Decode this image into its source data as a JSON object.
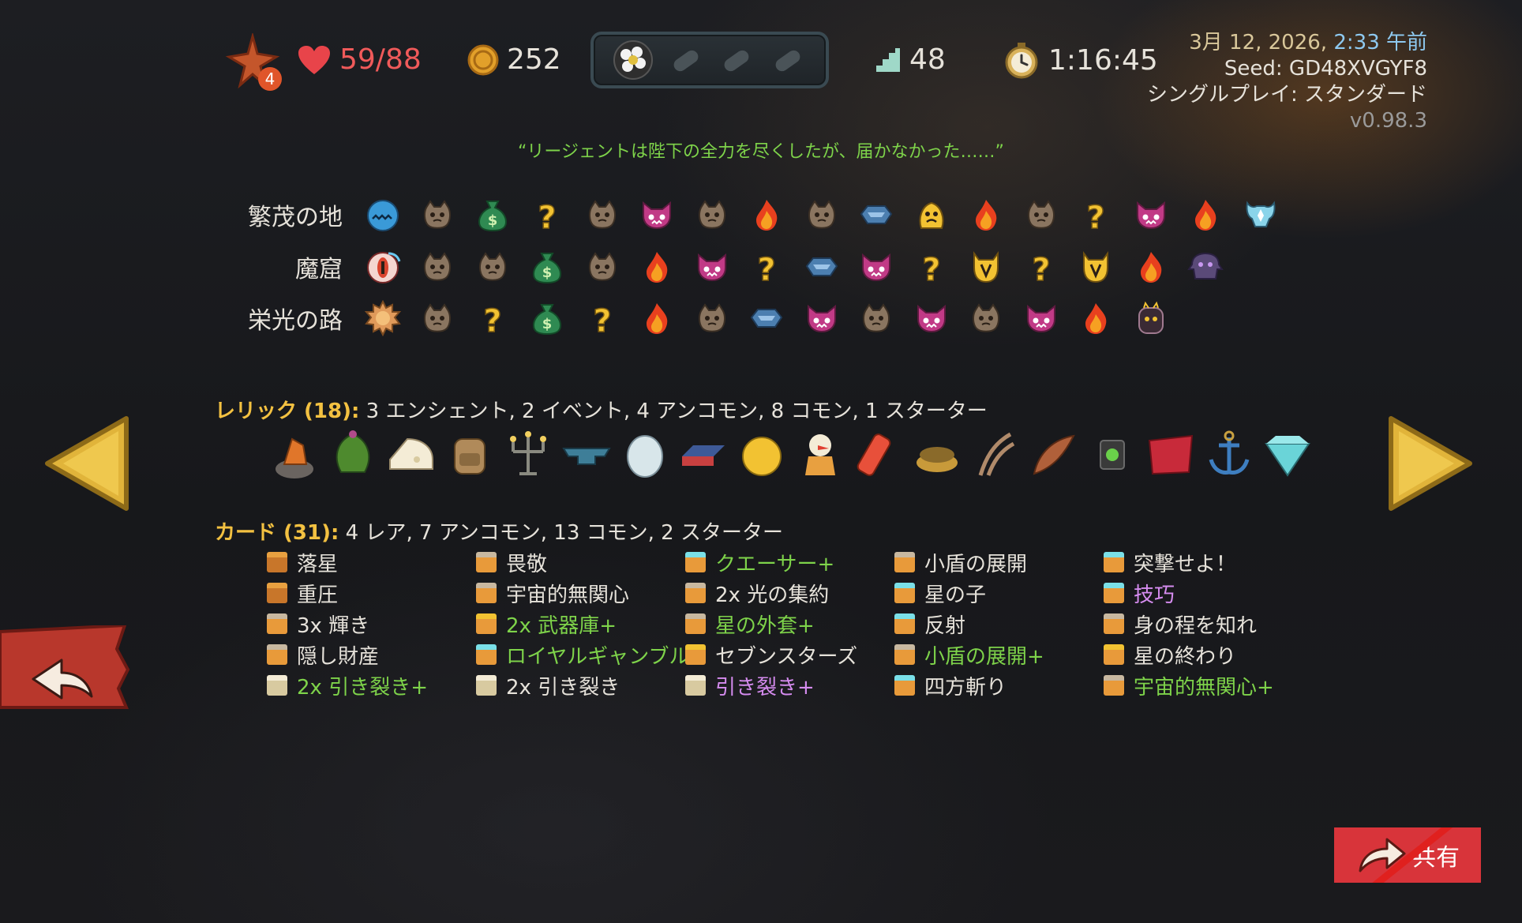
{
  "topbar": {
    "ascension_level": "4",
    "hp": "59/88",
    "gold": "252",
    "floor": "48",
    "time": "1:16:45"
  },
  "info": {
    "date": "3月 12, 2026,",
    "time_ago": "2:33 午前",
    "seed": "Seed: GD48XVGYF8",
    "mode": "シングルプレイ: スタンダード",
    "version": "v0.98.3"
  },
  "quote": "“リージェントは陛下の全力を尽くしたが、届かなかった……”",
  "acts": [
    {
      "name": "繁茂の地",
      "nodes": [
        "boss-blue-slime",
        "monster",
        "treasure-bag",
        "unknown",
        "monster",
        "elite",
        "monster",
        "rest",
        "monster",
        "chest",
        "ancient",
        "rest",
        "monster",
        "unknown",
        "elite",
        "rest",
        "boss-white"
      ]
    },
    {
      "name": "魔窟",
      "nodes": [
        "boss-eye",
        "monster",
        "monster",
        "treasure-bag",
        "monster",
        "rest",
        "elite",
        "unknown",
        "chest",
        "elite",
        "unknown",
        "event-devil",
        "unknown",
        "event-devil",
        "rest",
        "boss-purple"
      ]
    },
    {
      "name": "栄光の路",
      "nodes": [
        "boss-sun",
        "monster",
        "unknown",
        "treasure-bag",
        "unknown",
        "rest",
        "monster",
        "chest",
        "elite",
        "monster",
        "elite",
        "monster",
        "elite",
        "rest",
        "boss-dark"
      ]
    }
  ],
  "relics": {
    "label": "レリック (18):",
    "summary": "3 エンシェント, 2 イベント, 4 アンコモン, 8 コモン, 1 スターター",
    "items": [
      "crystal-rock-icon",
      "leaf-bundle-icon",
      "cheese-icon",
      "backpack-icon",
      "candelabra-icon",
      "anvil-icon",
      "egg-icon",
      "mattress-icon",
      "gold-ball-icon",
      "mascot-icon",
      "scroll-icon",
      "crown-icon",
      "claw-icon",
      "horn-icon",
      "lantern-icon",
      "pillow-icon",
      "anchor-icon",
      "gem-icon"
    ]
  },
  "cards": {
    "label": "カード (31):",
    "summary": "4 レア, 7 アンコモン, 13 コモン, 2 スターター",
    "columns": [
      [
        {
          "name": "落星",
          "color": "white",
          "icon": "orange"
        },
        {
          "name": "重圧",
          "color": "white",
          "icon": "orange"
        },
        {
          "name": "3x 輝き",
          "color": "white",
          "icon": "grey"
        },
        {
          "name": "隠し財産",
          "color": "white",
          "icon": "grey"
        },
        {
          "name": "2x 引き裂き+",
          "color": "green",
          "icon": "white"
        }
      ],
      [
        {
          "name": "畏敬",
          "color": "white",
          "icon": "grey"
        },
        {
          "name": "宇宙的無関心",
          "color": "white",
          "icon": "grey"
        },
        {
          "name": "2x 武器庫+",
          "color": "green",
          "icon": "gold"
        },
        {
          "name": "ロイヤルギャンブル+",
          "color": "green",
          "icon": "teal"
        },
        {
          "name": "2x 引き裂き",
          "color": "white",
          "icon": "white"
        }
      ],
      [
        {
          "name": "クエーサー+",
          "color": "green",
          "icon": "teal"
        },
        {
          "name": "2x 光の集約",
          "color": "white",
          "icon": "grey"
        },
        {
          "name": "星の外套+",
          "color": "green",
          "icon": "grey"
        },
        {
          "name": "セブンスターズ",
          "color": "white",
          "icon": "gold"
        },
        {
          "name": "引き裂き+",
          "color": "purple",
          "icon": "white"
        }
      ],
      [
        {
          "name": "小盾の展開",
          "color": "white",
          "icon": "grey"
        },
        {
          "name": "星の子",
          "color": "white",
          "icon": "teal"
        },
        {
          "name": "反射",
          "color": "white",
          "icon": "teal"
        },
        {
          "name": "小盾の展開+",
          "color": "green",
          "icon": "grey"
        },
        {
          "name": "四方斬り",
          "color": "white",
          "icon": "teal"
        }
      ],
      [
        {
          "name": "突撃せよ！",
          "color": "white",
          "icon": "teal"
        },
        {
          "name": "技巧",
          "color": "purple",
          "icon": "teal"
        },
        {
          "name": "身の程を知れ",
          "color": "white",
          "icon": "grey"
        },
        {
          "name": "星の終わり",
          "color": "white",
          "icon": "gold"
        },
        {
          "name": "宇宙的無関心+",
          "color": "green",
          "icon": "grey"
        }
      ]
    ]
  },
  "share_label": "共有",
  "colors": {
    "accent_gold": "#f3c141",
    "upgraded_green": "#7ed34a",
    "hp_red": "#f05a5a",
    "share_red": "#d8343a"
  }
}
